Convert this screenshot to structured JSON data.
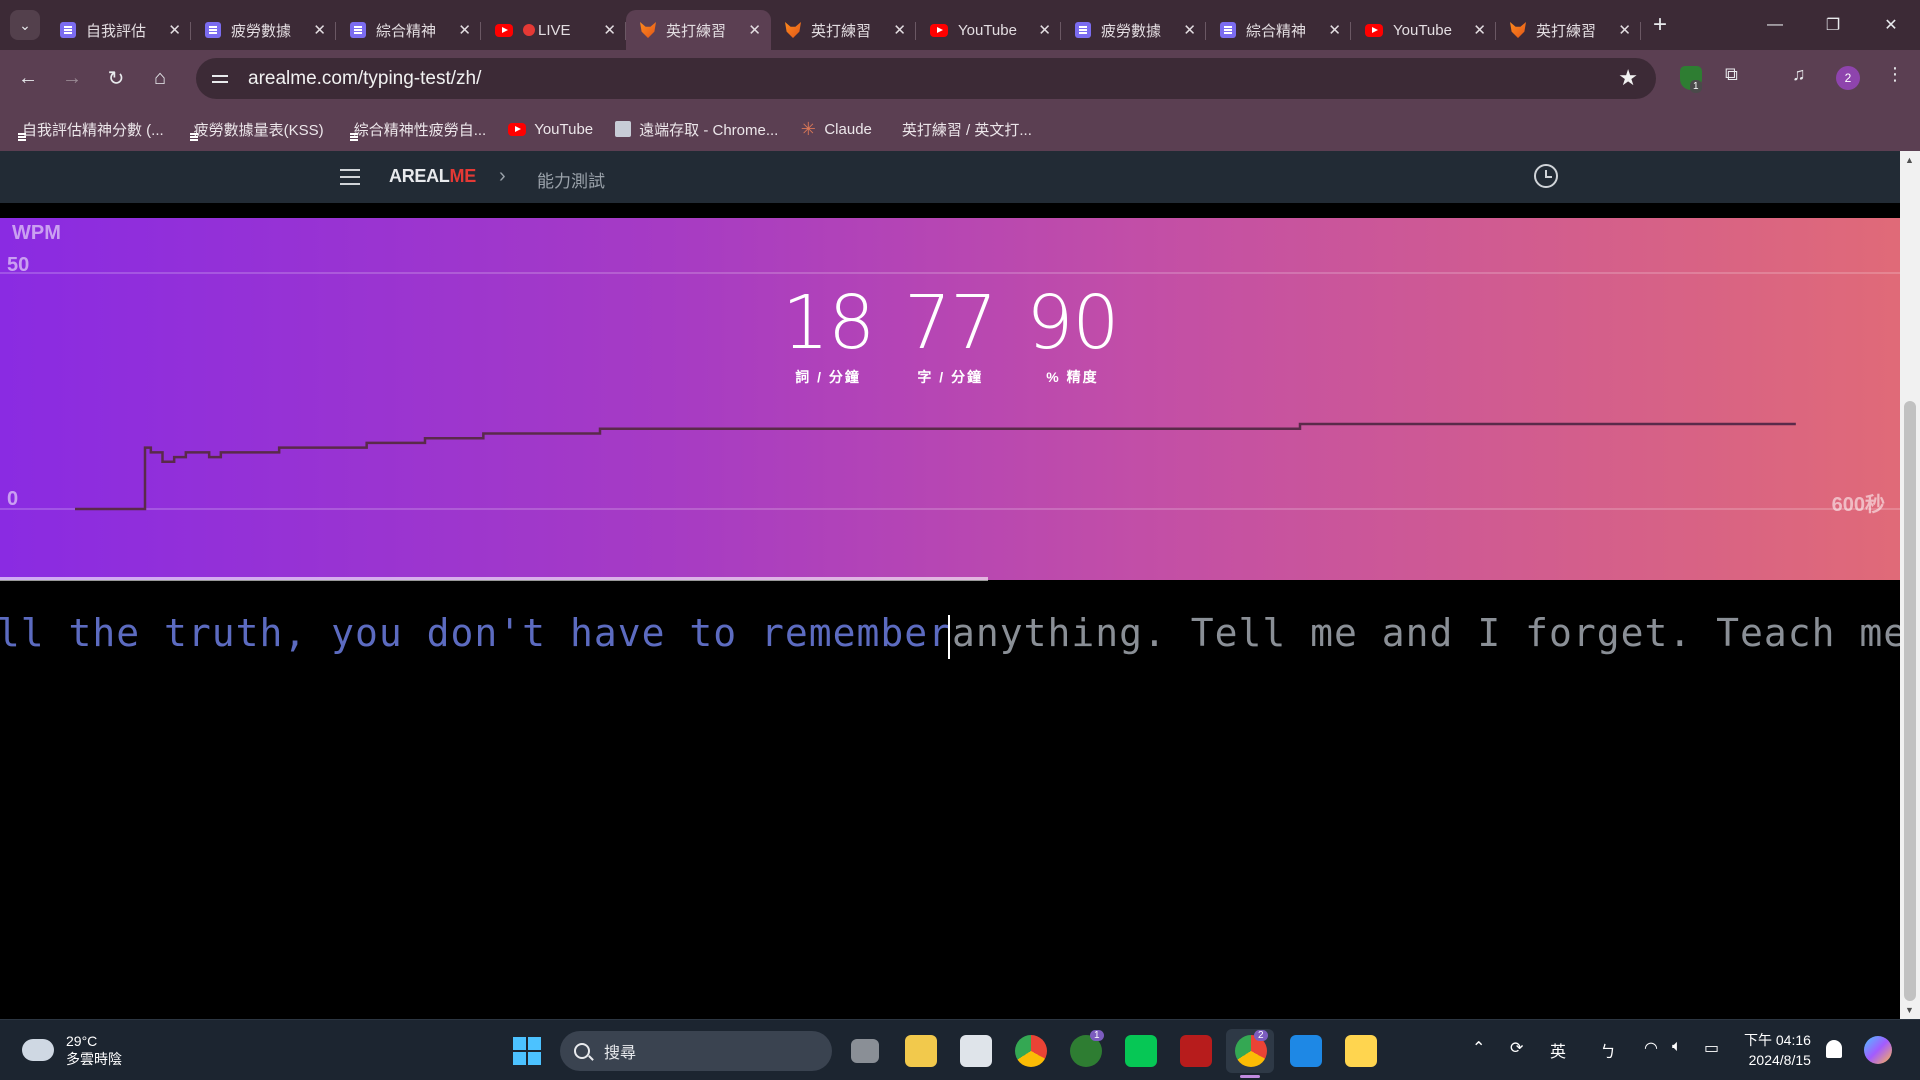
{
  "browser": {
    "tabs": [
      {
        "title": "自我評估",
        "favicon": "doc-icon"
      },
      {
        "title": "疲勞數據",
        "favicon": "doc-icon"
      },
      {
        "title": "綜合精神",
        "favicon": "doc-icon"
      },
      {
        "title": "LIVE",
        "favicon": "youtube-icon",
        "live": true
      },
      {
        "title": "英打練習",
        "favicon": "fox-icon",
        "active": true
      },
      {
        "title": "英打練習",
        "favicon": "fox-icon"
      },
      {
        "title": "YouTube",
        "favicon": "youtube-icon"
      },
      {
        "title": "疲勞數據",
        "favicon": "doc-icon"
      },
      {
        "title": "綜合精神",
        "favicon": "doc-icon"
      },
      {
        "title": "YouTube",
        "favicon": "youtube-icon"
      },
      {
        "title": "英打練習",
        "favicon": "fox-icon"
      }
    ],
    "new_tab": "+",
    "url": "arealme.com/typing-test/zh/",
    "extension_badge": "1",
    "profile_badge": "2",
    "bookmarks": [
      {
        "label": "自我評估精神分數 (...",
        "favicon": "doc-icon"
      },
      {
        "label": "疲勞數據量表(KSS)",
        "favicon": "doc-icon"
      },
      {
        "label": "綜合精神性疲勞自...",
        "favicon": "doc-icon"
      },
      {
        "label": "YouTube",
        "favicon": "youtube-icon"
      },
      {
        "label": "遠端存取 - Chrome...",
        "favicon": "remote-desktop-icon"
      },
      {
        "label": "Claude",
        "favicon": "claude-icon"
      },
      {
        "label": "英打練習 / 英文打...",
        "favicon": "fox-icon"
      }
    ]
  },
  "site": {
    "logo_main": "AREAL",
    "logo_accent": "ME",
    "breadcrumb": "能力測試"
  },
  "stats": [
    {
      "value": "18",
      "label": "詞 / 分鐘"
    },
    {
      "value": "77",
      "label": "字 / 分鐘"
    },
    {
      "value": "90",
      "label": "% 精度"
    }
  ],
  "chart_data": {
    "type": "line",
    "title": "WPM",
    "ylim": [
      0,
      50
    ],
    "ytick_max": "50",
    "ytick_min": "0",
    "xtick_max": "600秒",
    "xlim": [
      0,
      600
    ],
    "x": [
      0,
      22,
      24,
      26,
      30,
      34,
      38,
      42,
      46,
      50,
      60,
      70,
      80,
      90,
      100,
      120,
      140,
      160,
      180,
      200,
      230,
      260,
      300,
      340,
      380,
      420,
      460,
      500,
      540,
      580,
      590
    ],
    "y": [
      0,
      0,
      13,
      12,
      10,
      11,
      12,
      12,
      11,
      12,
      12,
      13,
      13,
      13,
      14,
      15,
      16,
      16,
      17,
      17,
      17,
      17,
      17,
      17,
      17,
      18,
      18,
      18,
      18,
      18,
      18
    ],
    "grid": true,
    "progress_fraction": 0.52
  },
  "typing": {
    "typed_text": "If you tell the truth, you don't have to remember ",
    "remaining_text": "anything. Tell me and I forget. Teach me and I"
  },
  "taskbar": {
    "weather_temp": "29°C",
    "weather_desc": "多雲時陰",
    "search_placeholder": "搜尋",
    "ime_label": "英",
    "ime_mode": "ㄅ",
    "time": "下午 04:16",
    "date": "2024/8/15",
    "xbox_badge": "1",
    "chrome_badge": "2"
  }
}
